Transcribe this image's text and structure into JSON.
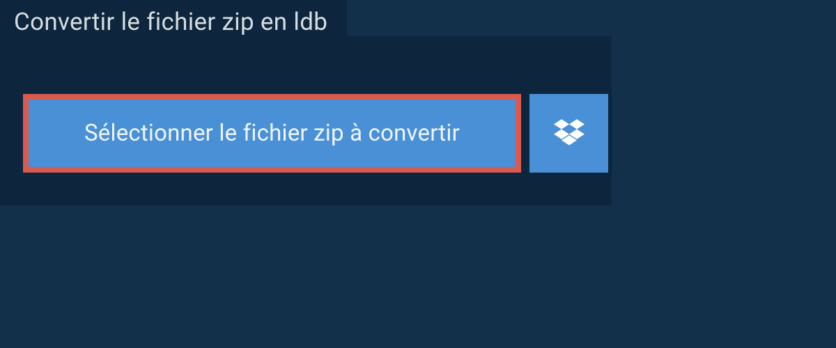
{
  "header": {
    "title": "Convertir le fichier zip en ldb"
  },
  "actions": {
    "select_label": "Sélectionner le fichier zip à convertir"
  }
}
